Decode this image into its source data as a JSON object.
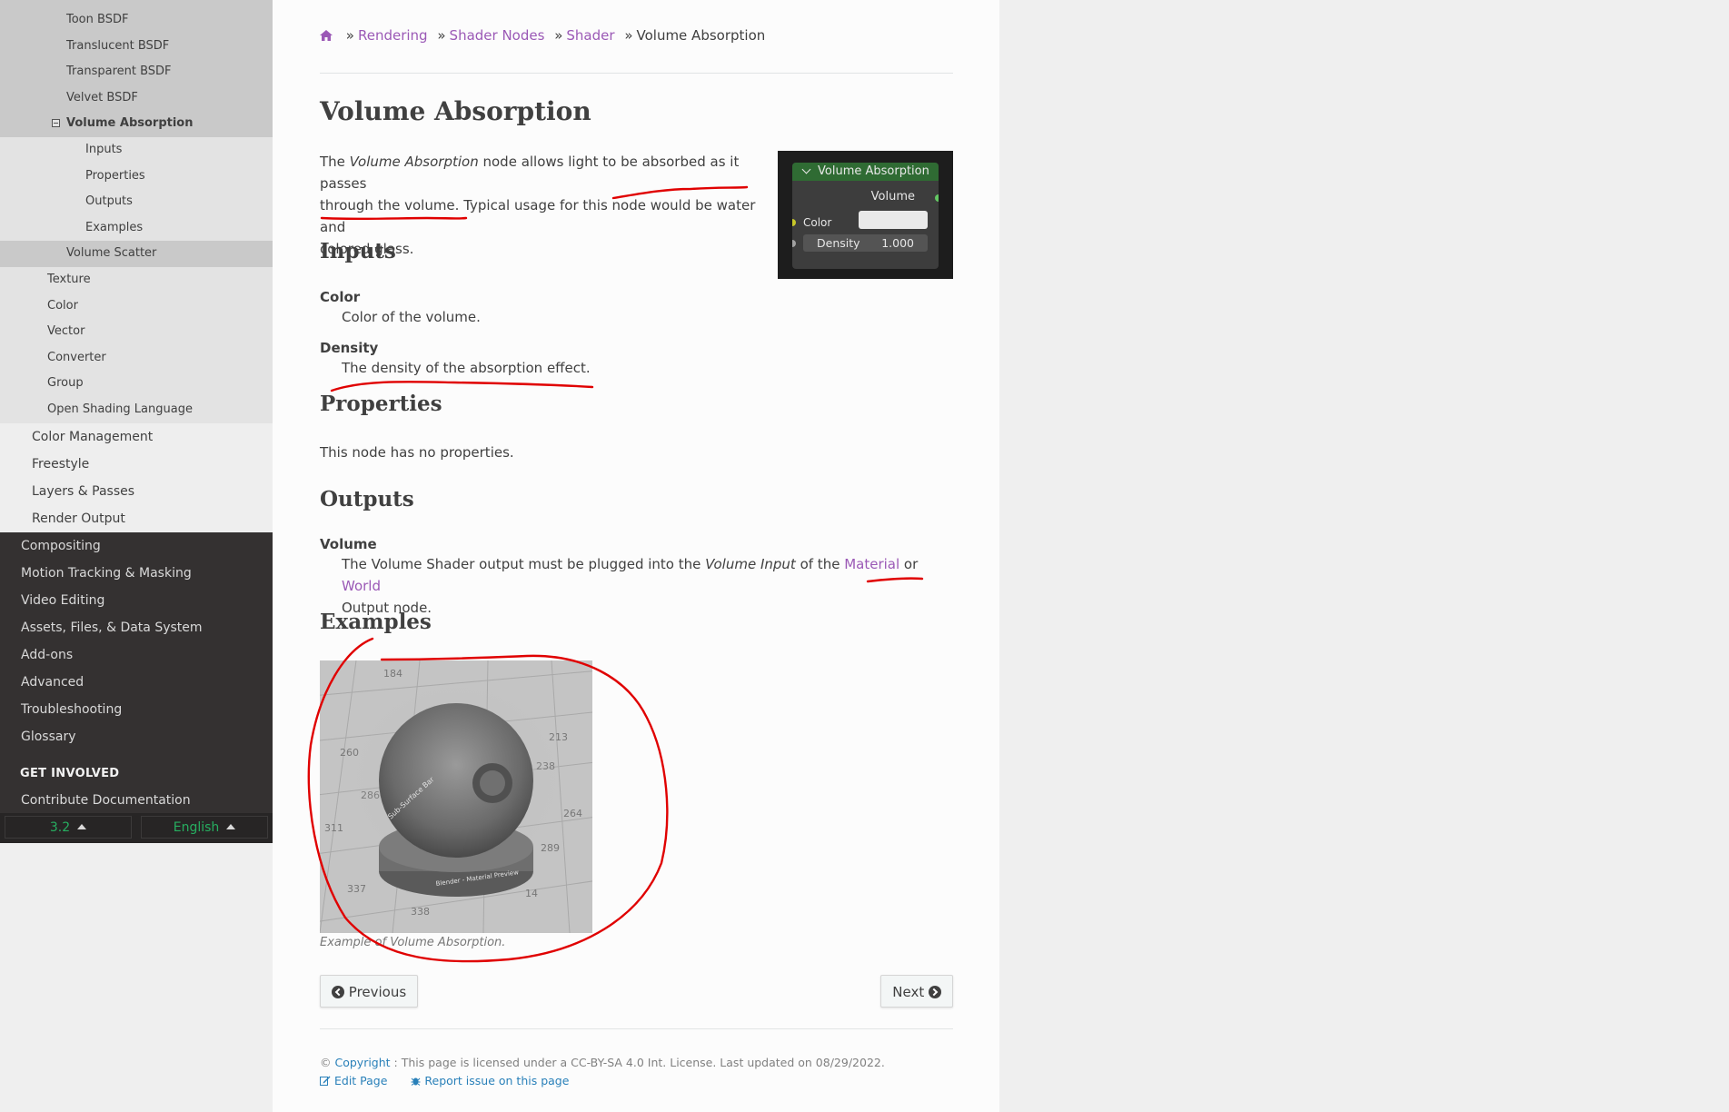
{
  "sidebar": {
    "grey_items": [
      "Toon BSDF",
      "Translucent BSDF",
      "Transparent BSDF",
      "Velvet BSDF"
    ],
    "current": "Volume Absorption",
    "sub_items": [
      "Inputs",
      "Properties",
      "Outputs",
      "Examples"
    ],
    "after_current": "Volume Scatter",
    "level2_items": [
      "Texture",
      "Color",
      "Vector",
      "Converter",
      "Group",
      "Open Shading Language"
    ],
    "level1_items": [
      "Color Management",
      "Freestyle",
      "Layers & Passes",
      "Render Output"
    ],
    "top_items": [
      "Compositing",
      "Motion Tracking & Masking",
      "Video Editing",
      "Assets, Files, & Data System",
      "Add-ons",
      "Advanced",
      "Troubleshooting",
      "Glossary"
    ],
    "caption": "GET INVOLVED",
    "contribute": "Contribute Documentation",
    "version": "3.2",
    "language": "English"
  },
  "breadcrumb": {
    "items": [
      "Rendering",
      "Shader Nodes",
      "Shader"
    ],
    "current": "Volume Absorption",
    "separator": "»"
  },
  "page": {
    "title": "Volume Absorption",
    "intro": {
      "pre": "The ",
      "em": "Volume Absorption",
      "post_line1": " node allows light to be absorbed as it passes",
      "line2": "through the volume. Typical usage for this node would be water and",
      "line3": "colored glass."
    },
    "inputs_heading": "Inputs",
    "inputs": [
      {
        "term": "Color",
        "desc": "Color of the volume."
      },
      {
        "term": "Density",
        "desc": "The density of the absorption effect."
      }
    ],
    "properties_heading": "Properties",
    "properties_text": "This node has no properties.",
    "outputs_heading": "Outputs",
    "output_term": "Volume",
    "output_desc": {
      "a": "The Volume Shader output must be plugged into the ",
      "em": "Volume Input",
      "b": " of the ",
      "link1": "Material",
      "c": " or ",
      "link2": "World",
      "d": "Output node."
    },
    "examples_heading": "Examples",
    "figure_caption": "Example of Volume Absorption."
  },
  "node_image": {
    "header": "Volume Absorption",
    "output": "Volume",
    "color_label": "Color",
    "density_label": "Density",
    "density_value": "1.000"
  },
  "example_image": {
    "label_sphere": "Sub-Surface Bar",
    "label_base": "Blender - Material Preview",
    "grid_numbers": [
      "184",
      "213",
      "260",
      "238",
      "264",
      "286",
      "289",
      "311",
      "337",
      "338",
      "14"
    ]
  },
  "nav": {
    "previous": "Previous",
    "next": "Next"
  },
  "footer": {
    "copyright_symbol": "©",
    "copyright_link": "Copyright",
    "license": ": This page is licensed under a CC-BY-SA 4.0 Int. License. Last updated on 08/29/2022.",
    "edit": "Edit Page",
    "report": "Report issue on this page"
  },
  "colors": {
    "link": "#9b59b6",
    "footer_link": "#2980b9",
    "sidebar_dark": "#343131",
    "version_green": "#27ae60",
    "annotation_red": "#e00000"
  }
}
